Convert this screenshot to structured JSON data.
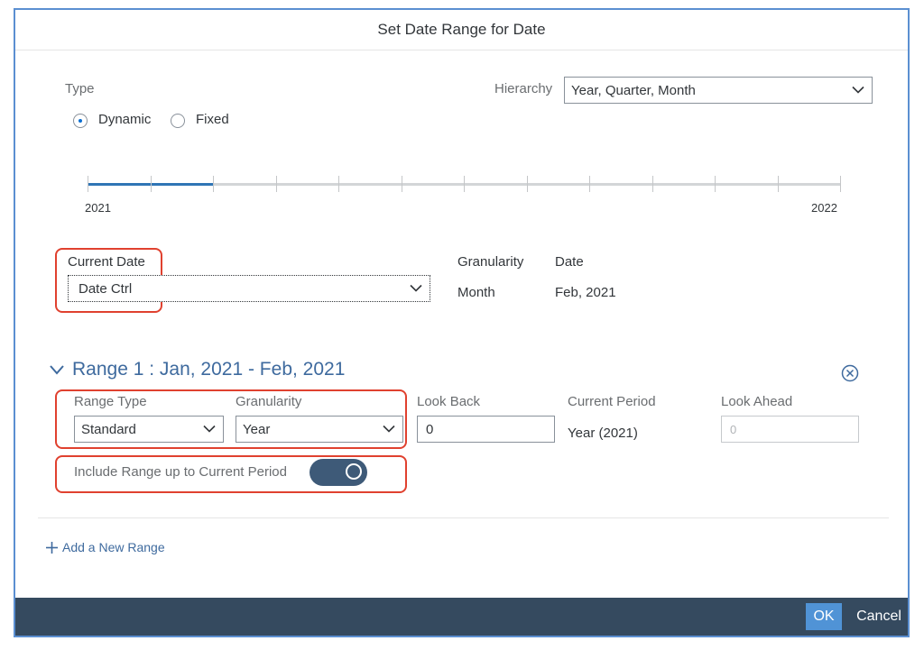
{
  "dialog": {
    "title": "Set Date Range for Date"
  },
  "type": {
    "label": "Type",
    "options": [
      {
        "label": "Dynamic",
        "selected": true
      },
      {
        "label": "Fixed",
        "selected": false
      }
    ]
  },
  "hierarchy": {
    "label": "Hierarchy",
    "value": "Year, Quarter, Month"
  },
  "timeline": {
    "start_label": "2021",
    "end_label": "2022",
    "selected_fraction": 0.1667,
    "tick_count": 13
  },
  "current_date": {
    "label": "Current Date",
    "value": "Date Ctrl"
  },
  "info": {
    "granularity_label": "Granularity",
    "granularity_value": "Month",
    "date_label": "Date",
    "date_value": "Feb, 2021"
  },
  "range": {
    "title": "Range 1 : Jan, 2021 - Feb, 2021",
    "range_type_label": "Range Type",
    "range_type_value": "Standard",
    "granularity_label": "Granularity",
    "granularity_value": "Year",
    "look_back_label": "Look Back",
    "look_back_value": "0",
    "current_period_label": "Current Period",
    "current_period_value": "Year (2021)",
    "look_ahead_label": "Look Ahead",
    "look_ahead_placeholder": "0",
    "include_label": "Include Range up to Current Period",
    "include_on": true
  },
  "add_range": {
    "label": "Add a New Range"
  },
  "footer": {
    "ok_label": "OK",
    "cancel_label": "Cancel"
  },
  "colors": {
    "accent": "#0a6ed1",
    "highlight": "#e0412f",
    "footer_bg": "#354a5f",
    "range_title": "#3e6a9e"
  }
}
